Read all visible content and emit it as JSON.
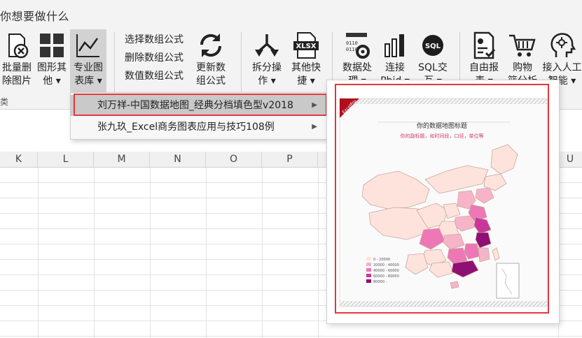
{
  "topbar": {
    "hint": "你想要做什么"
  },
  "ribbon": {
    "group_label": "类",
    "buttons": [
      {
        "label": "批量删\n除图片",
        "icon": "delete-image-icon"
      },
      {
        "label": "图形其\n他 ▾",
        "icon": "grid-icon"
      },
      {
        "label": "专业图\n表库 ▾",
        "icon": "chart-line-icon"
      },
      {
        "label": "更新数\n组公式",
        "icon": "refresh-icon"
      },
      {
        "label": "拆分操\n作 ▾",
        "icon": "split-icon"
      },
      {
        "label": "其他快\n捷 ▾",
        "icon": "xlsx-icon"
      },
      {
        "label": "数据处\n理 ▾",
        "icon": "data-gear-icon"
      },
      {
        "label": "连接\nPbid ▾",
        "icon": "powerbi-icon"
      },
      {
        "label": "SQL交\n互 ▾",
        "icon": "sql-icon"
      },
      {
        "label": "自由报\n表 ▾",
        "icon": "report-icon"
      },
      {
        "label": "购物\n篮分析",
        "icon": "cart-icon"
      },
      {
        "label": "接入人工\n智能 ▾",
        "icon": "ai-head-icon"
      }
    ],
    "formula_items": [
      "选择数组公式",
      "删除数组公式",
      "数值数组公式"
    ]
  },
  "sheet": {
    "columns": [
      "K",
      "L",
      "M",
      "N",
      "O",
      "P",
      "U"
    ]
  },
  "dropdown": {
    "items": [
      "刘万祥-中国数据地图_经典分档填色型v2018",
      "张九玖_Excel商务图表应用与技巧108例"
    ]
  },
  "preview": {
    "ribbon_text": "ExcelPro",
    "title": "你的数据地图标题",
    "subtitle": "你的副标题，如时间段，口径，单位等",
    "legend": [
      "0 - 20000",
      "20000 - 40000",
      "40000 - 60000",
      "60000 - 80000",
      "80000 -"
    ],
    "colors": {
      "level1": "#fde3dc",
      "level2": "#f7b4c8",
      "level3": "#ee77b6",
      "level4": "#c9379a",
      "level5": "#8e1072"
    }
  }
}
